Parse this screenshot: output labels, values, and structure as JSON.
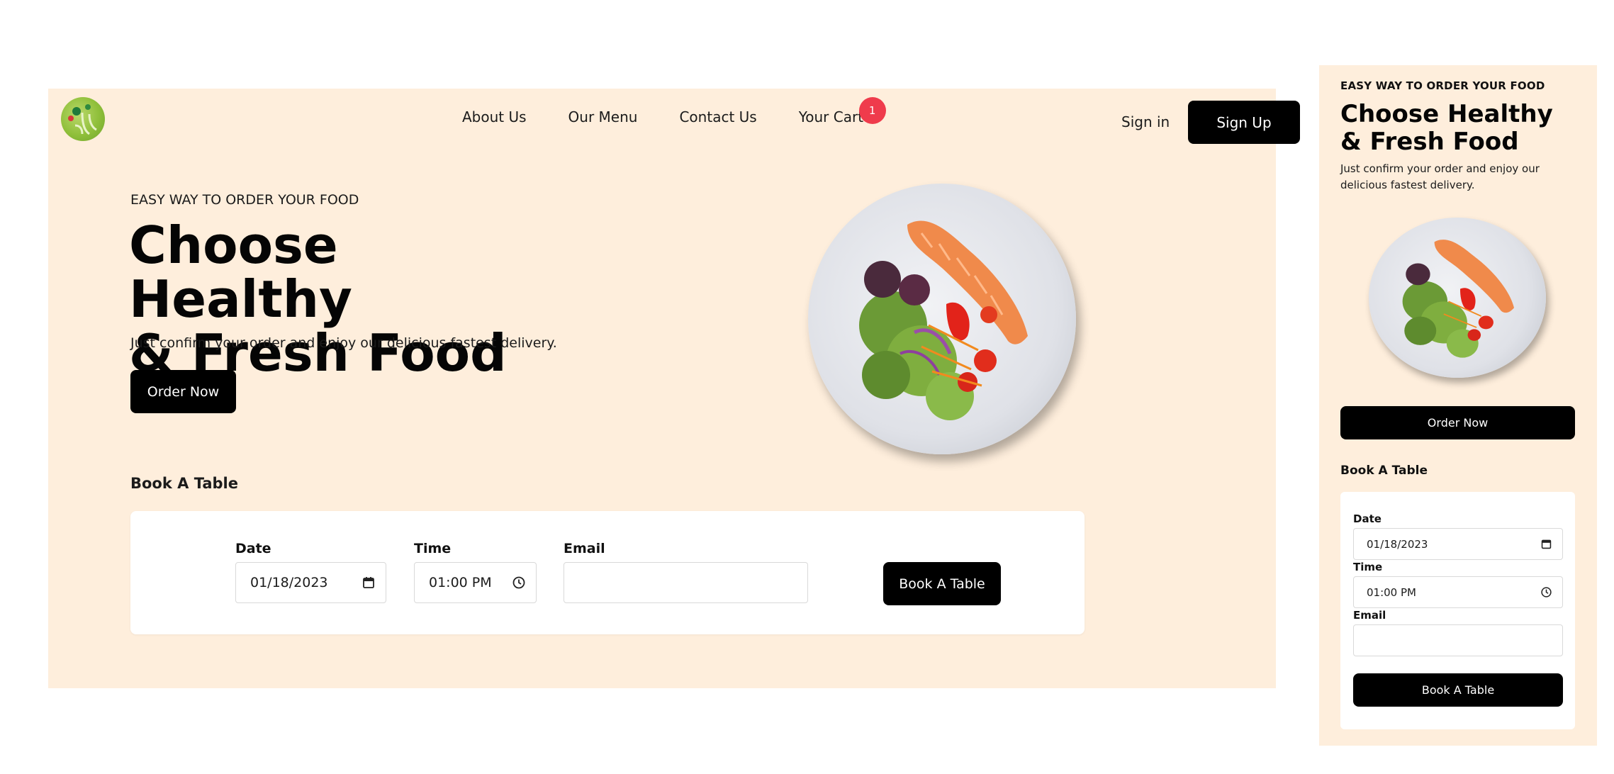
{
  "nav": {
    "items": [
      {
        "label": "About Us"
      },
      {
        "label": "Our Menu"
      },
      {
        "label": "Contact Us"
      },
      {
        "label": "Your Cart"
      }
    ],
    "cart_count": "1",
    "signin_label": "Sign in",
    "signup_label": "Sign Up"
  },
  "hero": {
    "eyebrow": "EASY WAY TO ORDER YOUR FOOD",
    "title_line1": "Choose Healthy",
    "title_line2": "& Fresh Food",
    "subtitle": "Just confirm your order and enjoy our delicious fastest delivery.",
    "order_button": "Order Now"
  },
  "booking": {
    "title": "Book A Table",
    "date_label": "Date",
    "date_value": "01/18/2023",
    "time_label": "Time",
    "time_value": "01:00 PM",
    "email_label": "Email",
    "email_value": "",
    "button_label": "Book A Table"
  },
  "colors": {
    "background": "#FEEEDC",
    "button": "#000000",
    "badge": "#EF3B4C",
    "card": "#FFFFFF"
  },
  "icons": [
    "logo-icon",
    "calendar-icon",
    "clock-icon",
    "salad-plate-image"
  ]
}
